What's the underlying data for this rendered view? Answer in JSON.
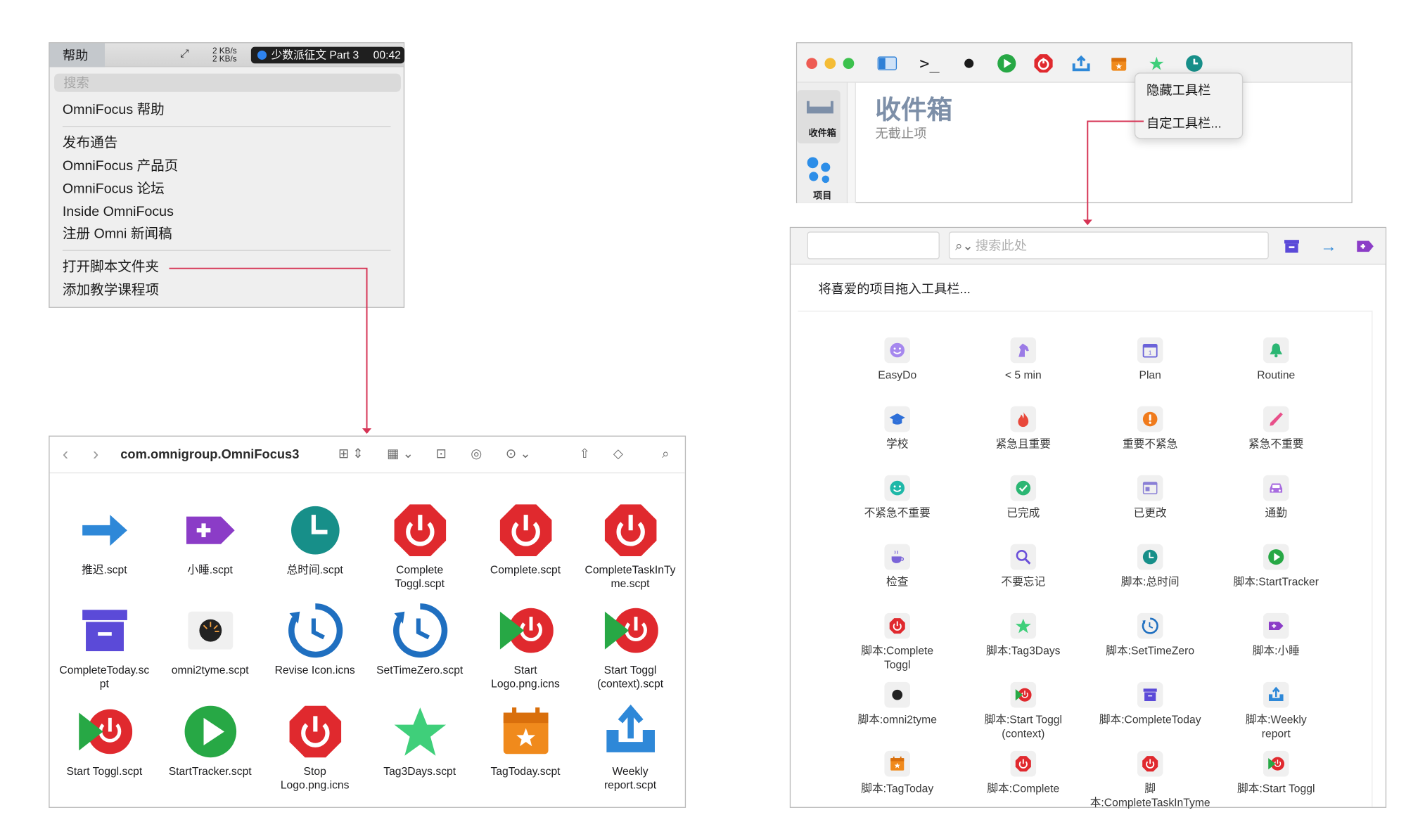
{
  "menu": {
    "menubar_title": "帮助",
    "speed_up": "2 KB/s",
    "speed_down": "2 KB/s",
    "now_playing": "少数派征文 Part 3",
    "now_playing_time": "00:42",
    "search_placeholder": "搜索",
    "items": [
      "OmniFocus 帮助",
      "发布通告",
      "OmniFocus 产品页",
      "OmniFocus 论坛",
      "Inside OmniFocus",
      "注册 Omni 新闻稿",
      "打开脚本文件夹",
      "添加教学课程项"
    ]
  },
  "finder": {
    "title": "com.omnigroup.OmniFocus3",
    "files": [
      {
        "label": "推迟.scpt",
        "icon": "arrow-right-icon"
      },
      {
        "label": "小睡.scpt",
        "icon": "tag-plus-icon"
      },
      {
        "label": "总时间.scpt",
        "icon": "clock-icon"
      },
      {
        "label": "Complete\nToggl.scpt",
        "icon": "power-octagon-icon"
      },
      {
        "label": "Complete.scpt",
        "icon": "power-octagon-icon"
      },
      {
        "label": "CompleteTaskInTy\nme.scpt",
        "icon": "power-octagon-icon"
      },
      {
        "label": "CompleteToday.sc\npt",
        "icon": "archive-box-icon"
      },
      {
        "label": "omni2tyme.scpt",
        "icon": "dial-icon"
      },
      {
        "label": "Revise Icon.icns",
        "icon": "timer-reset-icon"
      },
      {
        "label": "SetTimeZero.scpt",
        "icon": "timer-reset-icon"
      },
      {
        "label": "Start\nLogo.png.icns",
        "icon": "play-power-icon"
      },
      {
        "label": "Start Toggl\n(context).scpt",
        "icon": "play-power-icon"
      },
      {
        "label": "Start Toggl.scpt",
        "icon": "play-power-icon"
      },
      {
        "label": "StartTracker.scpt",
        "icon": "play-circle-icon"
      },
      {
        "label": "Stop\nLogo.png.icns",
        "icon": "power-octagon-icon"
      },
      {
        "label": "Tag3Days.scpt",
        "icon": "star-icon"
      },
      {
        "label": "TagToday.scpt",
        "icon": "calendar-star-icon"
      },
      {
        "label": "Weekly\nreport.scpt",
        "icon": "upload-tray-icon"
      }
    ]
  },
  "omnifocus": {
    "sidebar_inbox": "收件箱",
    "sidebar_projects": "项目",
    "inbox_title": "收件箱",
    "inbox_subtitle": "无截止项",
    "popup_hide": "隐藏工具栏",
    "popup_customize": "自定工具栏..."
  },
  "customize": {
    "search_placeholder": "搜索此处",
    "drag_title": "将喜爱的项目拖入工具栏...",
    "items": [
      {
        "label": "EasyDo",
        "icon": "smile-icon",
        "color": "#a688ee"
      },
      {
        "label": "< 5 min",
        "icon": "horse-icon",
        "color": "#9b7be6"
      },
      {
        "label": "Plan",
        "icon": "calendar-icon",
        "color": "#6b63d9"
      },
      {
        "label": "Routine",
        "icon": "bell-icon",
        "color": "#2bb673"
      },
      {
        "label": "学校",
        "icon": "graduation-cap-icon",
        "color": "#2e6fd8"
      },
      {
        "label": "紧急且重要",
        "icon": "flame-icon",
        "color": "#e8483a"
      },
      {
        "label": "重要不紧急",
        "icon": "exclamation-icon",
        "color": "#f07b1c"
      },
      {
        "label": "紧急不重要",
        "icon": "phone-icon",
        "color": "#e8508a"
      },
      {
        "label": "不紧急不重要",
        "icon": "smile-icon",
        "color": "#1fb8a8"
      },
      {
        "label": "已完成",
        "icon": "check-icon",
        "color": "#2bb673"
      },
      {
        "label": "已更改",
        "icon": "window-icon",
        "color": "#8a7fd6"
      },
      {
        "label": "通勤",
        "icon": "car-icon",
        "color": "#a86ce0"
      },
      {
        "label": "检查",
        "icon": "cup-icon",
        "color": "#7a64d8"
      },
      {
        "label": "不要忘记",
        "icon": "magnifier-icon",
        "color": "#6a4fd9"
      },
      {
        "label": "脚本:总时间",
        "icon": "clock-icon",
        "color": "#178f89"
      },
      {
        "label": "脚本:StartTracker",
        "icon": "play-circle-icon",
        "color": "#27a845"
      },
      {
        "label": "脚本:Complete\nToggl",
        "icon": "power-octagon-icon",
        "color": "#e0292e"
      },
      {
        "label": "脚本:Tag3Days",
        "icon": "star-icon",
        "color": "#3fcf7a"
      },
      {
        "label": "脚本:SetTimeZero",
        "icon": "timer-reset-icon",
        "color": "#1f6fc0"
      },
      {
        "label": "脚本:小睡",
        "icon": "tag-plus-icon",
        "color": "#8b3cc7"
      },
      {
        "label": "脚本:omni2tyme",
        "icon": "dot-icon",
        "color": "#222222"
      },
      {
        "label": "脚本:Start Toggl\n(context)",
        "icon": "play-power-icon",
        "color": "#e0292e"
      },
      {
        "label": "脚本:CompleteToday",
        "icon": "archive-box-icon",
        "color": "#5b4ad8"
      },
      {
        "label": "脚本:Weekly\nreport",
        "icon": "upload-tray-icon",
        "color": "#2e88d8"
      },
      {
        "label": "脚本:TagToday",
        "icon": "calendar-star-icon",
        "color": "#f08a1c"
      },
      {
        "label": "脚本:Complete",
        "icon": "power-octagon-icon",
        "color": "#e0292e"
      },
      {
        "label": "脚本:CompleteTaskInTyme",
        "icon": "power-octagon-icon",
        "color": "#e0292e"
      },
      {
        "label": "脚本:Start Toggl",
        "icon": "play-power-icon",
        "color": "#e0292e"
      }
    ]
  }
}
